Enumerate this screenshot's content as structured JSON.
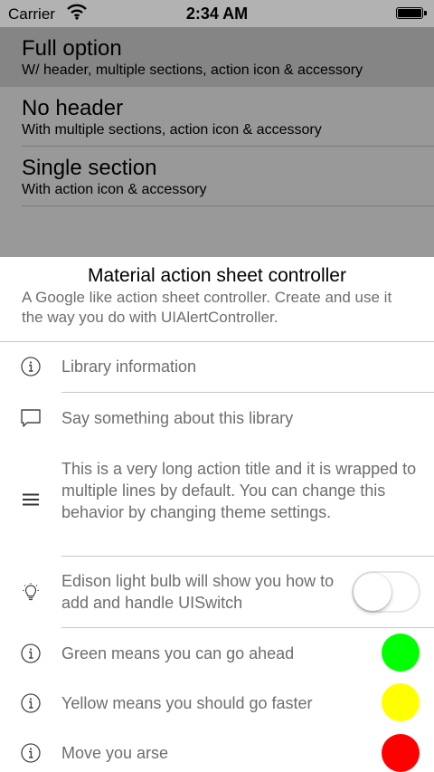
{
  "status_bar": {
    "carrier": "Carrier",
    "time": "2:34 AM"
  },
  "menu": [
    {
      "title": "Full option",
      "subtitle": "W/ header, multiple sections, action icon & accessory",
      "selected": true
    },
    {
      "title": "No header",
      "subtitle": "With multiple sections, action icon & accessory",
      "selected": false
    },
    {
      "title": "Single section",
      "subtitle": "With action icon & accessory",
      "selected": false
    }
  ],
  "sheet": {
    "title": "Material action sheet controller",
    "message": "A Google like action sheet controller. Create and use it the way you do with UIAlertController.",
    "actions": [
      {
        "icon": "info-icon",
        "label": "Library information"
      },
      {
        "icon": "speech-bubble-icon",
        "label": "Say something about this library"
      },
      {
        "icon": "menu-lines-icon",
        "label": "This is a very long action title and it is wrapped to multiple lines by default. You can change this behavior by changing theme settings."
      },
      {
        "icon": "light-bulb-icon",
        "label": "Edison light bulb will show you how to add and handle UISwitch",
        "switch_on": false
      },
      {
        "icon": "info-icon",
        "label": "Green means you can go ahead",
        "dot_color": "#00ff00"
      },
      {
        "icon": "info-icon",
        "label": "Yellow means you should go faster",
        "dot_color": "#ffff00"
      },
      {
        "icon": "info-icon",
        "label": "Move you arse",
        "dot_color": "#ff0000"
      }
    ]
  }
}
